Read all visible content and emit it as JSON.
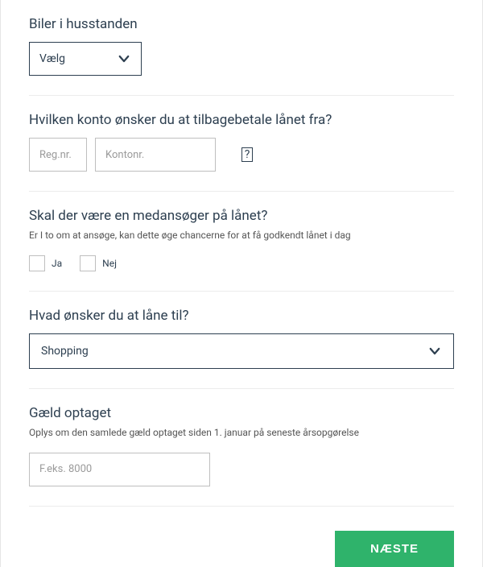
{
  "sections": {
    "cars": {
      "title": "Biler i husstanden",
      "select_value": "Vælg"
    },
    "account": {
      "title": "Hvilken konto ønsker du at tilbagebetale lånet fra?",
      "reg_placeholder": "Reg.nr.",
      "account_placeholder": "Kontonr.",
      "info_glyph": "?"
    },
    "coapplicant": {
      "title": "Skal der være en medansøger på lånet?",
      "helper": "Er I to om at ansøge, kan dette øge chancerne for at få godkendt lånet i dag",
      "yes_label": "Ja",
      "no_label": "Nej"
    },
    "purpose": {
      "title": "Hvad ønsker du at låne til?",
      "select_value": "Shopping"
    },
    "debt": {
      "title": "Gæld optaget",
      "helper": "Oplys om den samlede gæld optaget siden 1. januar på seneste årsopgørelse",
      "placeholder": "F.eks. 8000"
    }
  },
  "footer": {
    "next_label": "NÆSTE"
  },
  "colors": {
    "primary_text": "#2d3f50",
    "accent_green": "#2fb36b"
  }
}
